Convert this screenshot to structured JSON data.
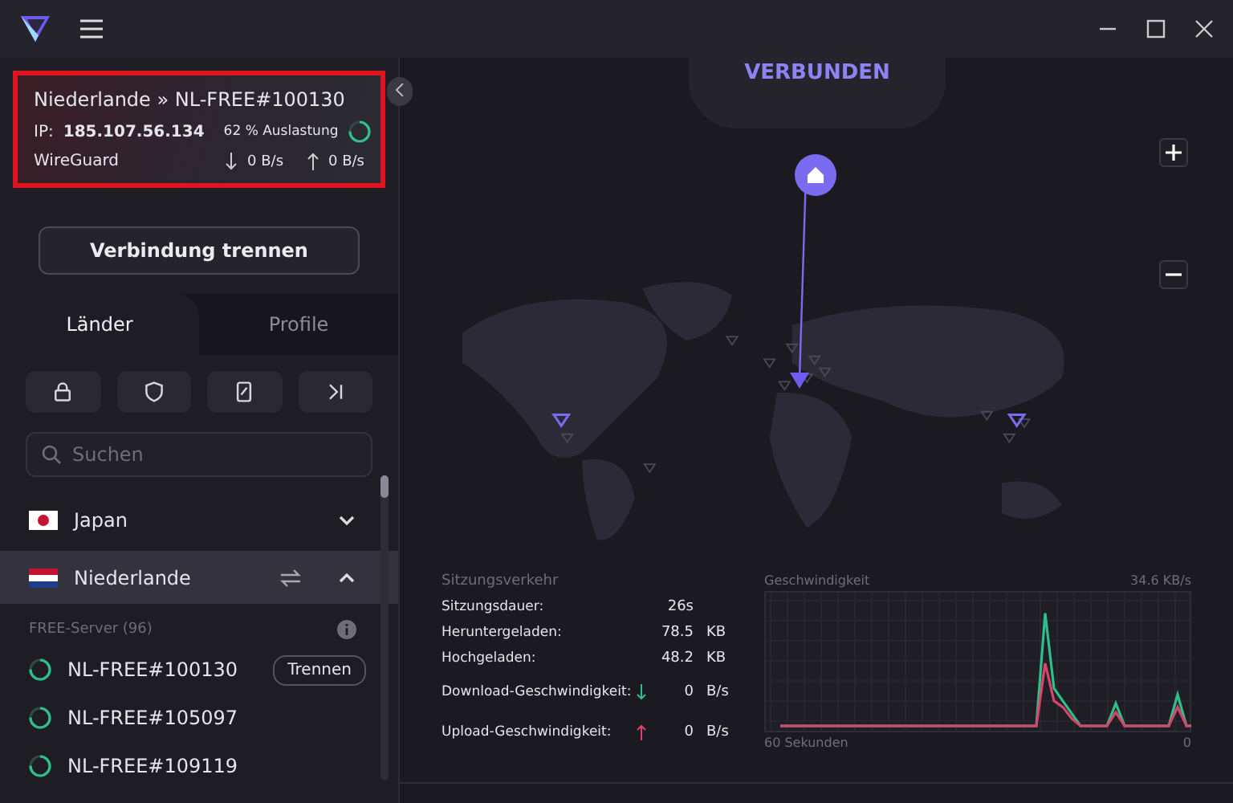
{
  "connection": {
    "location": "Niederlande » NL-FREE#100130",
    "ip_label": "IP:",
    "ip": "185.107.56.134",
    "load": "62 % Auslastung",
    "protocol": "WireGuard",
    "down": "0 B/s",
    "up": "0 B/s"
  },
  "disconnect_button": "Verbindung trennen",
  "tabs": [
    {
      "label": "Länder",
      "selected": true
    },
    {
      "label": "Profile",
      "selected": false
    }
  ],
  "filters": [
    {
      "kind": "lock"
    },
    {
      "kind": "shield"
    },
    {
      "kind": "card"
    },
    {
      "kind": "skip"
    }
  ],
  "search": {
    "placeholder": "Suchen"
  },
  "countries": [
    {
      "name": "Japan",
      "kind": "japan",
      "expanded": false
    },
    {
      "name": "Niederlande",
      "kind": "netherlands",
      "expanded": true
    }
  ],
  "server_group": {
    "title": "FREE-Server (96)",
    "servers": [
      {
        "name": "NL-FREE#100130",
        "action": "Trennen"
      },
      {
        "name": "NL-FREE#105097"
      },
      {
        "name": "NL-FREE#109119"
      }
    ]
  },
  "map": {
    "status": "VERBUNDEN"
  },
  "session": {
    "title": "Sitzungsverkehr",
    "rows": [
      {
        "label": "Sitzungsdauer:",
        "value": "26s"
      },
      {
        "label": "Heruntergeladen:",
        "value": "78.5",
        "unit": "KB"
      },
      {
        "label": "Hochgeladen:",
        "value": "48.2",
        "unit": "KB"
      },
      {
        "label": "Download-Geschwindigkeit:",
        "kind": "down",
        "value": "0",
        "unit": "B/s"
      },
      {
        "label": "Upload-Geschwindigkeit:",
        "kind": "up",
        "value": "0",
        "unit": "B/s"
      }
    ]
  },
  "speed": {
    "title": "Geschwindigkeit",
    "max": "34.6 KB/s",
    "x_start": "60 Sekunden",
    "x_end": "0"
  }
}
